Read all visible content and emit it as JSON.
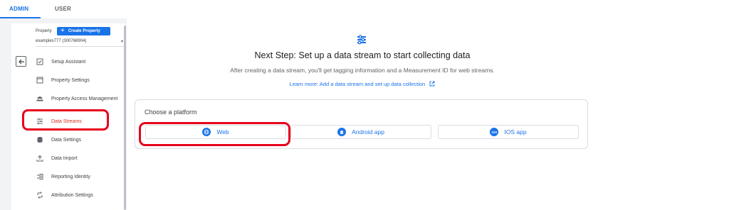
{
  "tabs": [
    {
      "label": "ADMIN",
      "active": true
    },
    {
      "label": "USER",
      "active": false
    }
  ],
  "sidebar": {
    "property_label": "Property",
    "create_button": "Create Property",
    "property_select_value": "examples777 (300768904)",
    "items": [
      {
        "label": "Setup Assistant",
        "icon": "checkbox-icon"
      },
      {
        "label": "Property Settings",
        "icon": "property-icon"
      },
      {
        "label": "Property Access Management",
        "icon": "people-icon"
      },
      {
        "label": "Data Streams",
        "icon": "data-streams-icon",
        "active": true
      },
      {
        "label": "Data Settings",
        "icon": "database-icon"
      },
      {
        "label": "Data Import",
        "icon": "upload-icon"
      },
      {
        "label": "Reporting Identity",
        "icon": "reporting-identity-icon"
      },
      {
        "label": "Attribution Settings",
        "icon": "attribution-icon"
      }
    ]
  },
  "main": {
    "headline": "Next Step: Set up a data stream to start collecting data",
    "subline": "After creating a data stream, you'll get tagging information and a Measurement ID for web streams.",
    "learn_link": "Learn more: Add a data stream and set up data collection",
    "choose_platform": "Choose a platform",
    "platforms": [
      {
        "label": "Web",
        "icon": "globe-icon"
      },
      {
        "label": "Android app",
        "icon": "android-icon"
      },
      {
        "label": "IOS app",
        "icon": "ios-icon",
        "icon_text": "iOS"
      }
    ]
  },
  "colors": {
    "accent": "#1a73e8",
    "highlight": "#e8001c",
    "active_nav": "#d93025",
    "backdrop": "#f1f3f4"
  }
}
